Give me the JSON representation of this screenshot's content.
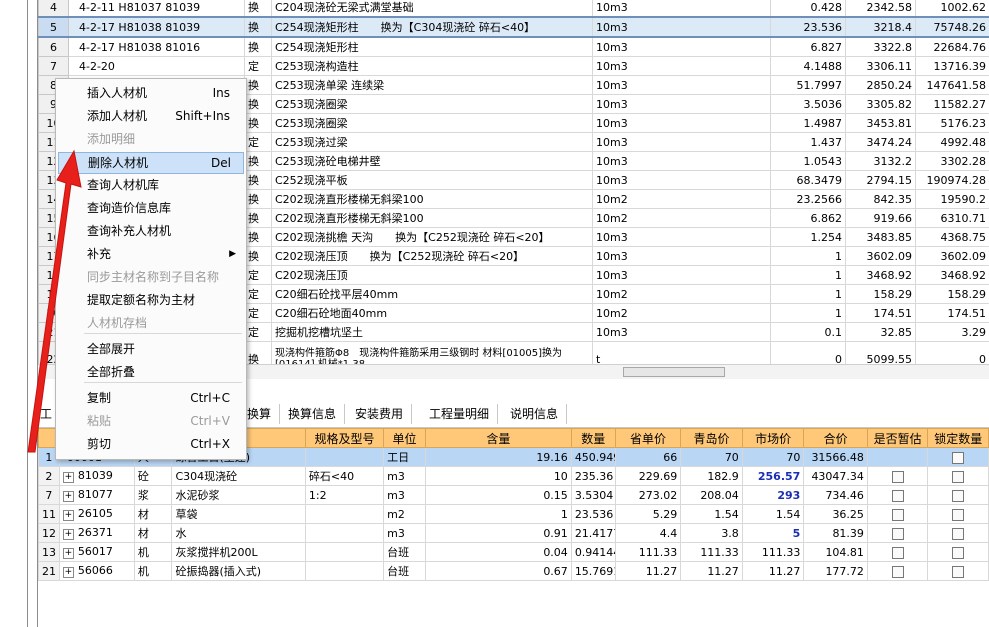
{
  "top_table": {
    "rows": [
      {
        "n": "4",
        "code": "4-2-11 H81037 81039",
        "type": "换",
        "name": "C204现浇砼无梁式满堂基础",
        "unit": "10m3",
        "qty": "0.428",
        "price": "2342.58",
        "total": "1002.62"
      },
      {
        "n": "5",
        "code": "4-2-17 H81038 81039",
        "type": "换",
        "name": "C254现浇矩形柱　　换为【C304现浇砼 碎石<40】",
        "unit": "10m3",
        "qty": "23.536",
        "price": "3218.4",
        "total": "75748.26"
      },
      {
        "n": "6",
        "code": "4-2-17 H81038 81016",
        "type": "换",
        "name": "C254现浇矩形柱",
        "unit": "10m3",
        "qty": "6.827",
        "price": "3322.8",
        "total": "22684.76"
      },
      {
        "n": "7",
        "code": "4-2-20",
        "type": "定",
        "name": "C253现浇构造柱",
        "unit": "10m3",
        "qty": "4.1488",
        "price": "3306.11",
        "total": "13716.39"
      },
      {
        "n": "8",
        "code": "",
        "type": "换",
        "name": "C253现浇单梁 连续梁",
        "unit": "10m3",
        "qty": "51.7997",
        "price": "2850.24",
        "total": "147641.58"
      },
      {
        "n": "9",
        "code": "",
        "type": "换",
        "name": "C253现浇圈梁",
        "unit": "10m3",
        "qty": "3.5036",
        "price": "3305.82",
        "total": "11582.27"
      },
      {
        "n": "10",
        "code": "",
        "type": "换",
        "name": "C253现浇圈梁",
        "unit": "10m3",
        "qty": "1.4987",
        "price": "3453.81",
        "total": "5176.23"
      },
      {
        "n": "11",
        "code": "",
        "type": "定",
        "name": "C253现浇过梁",
        "unit": "10m3",
        "qty": "1.437",
        "price": "3474.24",
        "total": "4992.48"
      },
      {
        "n": "12",
        "code": "",
        "type": "换",
        "name": "C253现浇砼电梯井壁",
        "unit": "10m3",
        "qty": "1.0543",
        "price": "3132.2",
        "total": "3302.28"
      },
      {
        "n": "13",
        "code": "",
        "type": "换",
        "name": "C252现浇平板",
        "unit": "10m3",
        "qty": "68.3479",
        "price": "2794.15",
        "total": "190974.28"
      },
      {
        "n": "14",
        "code": "",
        "type": "换",
        "name": "C202现浇直形楼梯无斜梁100",
        "unit": "10m2",
        "qty": "23.2566",
        "price": "842.35",
        "total": "19590.2"
      },
      {
        "n": "15",
        "code": "",
        "type": "换",
        "name": "C202现浇直形楼梯无斜梁100",
        "unit": "10m2",
        "qty": "6.862",
        "price": "919.66",
        "total": "6310.71"
      },
      {
        "n": "16",
        "code": "",
        "type": "换",
        "name": "C202现浇挑檐 天沟　　换为【C252现浇砼 碎石<20】",
        "unit": "10m3",
        "qty": "1.254",
        "price": "3483.85",
        "total": "4368.75"
      },
      {
        "n": "17",
        "code": "",
        "type": "换",
        "name": "C202现浇压顶　　换为【C252现浇砼 碎石<20】",
        "unit": "10m3",
        "qty": "1",
        "price": "3602.09",
        "total": "3602.09"
      },
      {
        "n": "18",
        "code": "",
        "type": "定",
        "name": "C202现浇压顶",
        "unit": "10m3",
        "qty": "1",
        "price": "3468.92",
        "total": "3468.92"
      },
      {
        "n": "19",
        "code": "",
        "type": "定",
        "name": "C20细石砼找平层40mm",
        "unit": "10m2",
        "qty": "1",
        "price": "158.29",
        "total": "158.29"
      },
      {
        "n": "20",
        "code": "",
        "type": "定",
        "name": "C20细石砼地面40mm",
        "unit": "10m2",
        "qty": "1",
        "price": "174.51",
        "total": "174.51"
      },
      {
        "n": "21",
        "code": "",
        "type": "定",
        "name": "挖掘机挖槽坑坚土",
        "unit": "10m3",
        "qty": "0.1",
        "price": "32.85",
        "total": "3.29"
      },
      {
        "n": "22",
        "code": "",
        "type": "换",
        "name": "现浇构件箍筋Φ8　现浇构件箍筋采用三级钢时 材料[01005]换为[01614],机械*1.38",
        "unit": "t",
        "qty": "0",
        "price": "5099.55",
        "total": "0"
      }
    ]
  },
  "tabs": [
    "工",
    "换算",
    "换算信息",
    "安装费用",
    "工程量明细",
    "说明信息"
  ],
  "bottom_table": {
    "headers": [
      "",
      "",
      "",
      "",
      "规格及型号",
      "单位",
      "含量",
      "数量",
      "省单价",
      "青岛价",
      "市场价",
      "合价",
      "是否暂估",
      "锁定数量"
    ],
    "rows": [
      {
        "n": "1",
        "code": "00001",
        "t": "人",
        "name": "综合工日(土建)",
        "spec": "",
        "unit": "工日",
        "content": "19.16",
        "qty": "450.949",
        "prov": "66",
        "qd": "70",
        "market": "70",
        "total": "31566.48"
      },
      {
        "n": "2",
        "code": "81039",
        "t": "砼",
        "name": "C304现浇砼",
        "spec": "碎石<40",
        "unit": "m3",
        "content": "10",
        "qty": "235.36",
        "prov": "229.69",
        "qd": "182.9",
        "market": "256.57",
        "total": "43047.34"
      },
      {
        "n": "7",
        "code": "81077",
        "t": "浆",
        "name": "水泥砂浆",
        "spec": "1:2",
        "unit": "m3",
        "content": "0.15",
        "qty": "3.5304",
        "prov": "273.02",
        "qd": "208.04",
        "market": "293",
        "total": "734.46"
      },
      {
        "n": "11",
        "code": "26105",
        "t": "材",
        "name": "草袋",
        "spec": "",
        "unit": "m2",
        "content": "1",
        "qty": "23.536",
        "prov": "5.29",
        "qd": "1.54",
        "market": "1.54",
        "total": "36.25"
      },
      {
        "n": "12",
        "code": "26371",
        "t": "材",
        "name": "水",
        "spec": "",
        "unit": "m3",
        "content": "0.91",
        "qty": "21.4177",
        "prov": "4.4",
        "qd": "3.8",
        "market": "5",
        "total": "81.39"
      },
      {
        "n": "13",
        "code": "56017",
        "t": "机",
        "name": "灰浆搅拌机200L",
        "spec": "",
        "unit": "台班",
        "content": "0.04",
        "qty": "0.94144",
        "prov": "111.33",
        "qd": "111.33",
        "market": "111.33",
        "total": "104.81"
      },
      {
        "n": "21",
        "code": "56066",
        "t": "机",
        "name": "砼振捣器(插入式)",
        "spec": "",
        "unit": "台班",
        "content": "0.67",
        "qty": "15.7691",
        "prov": "11.27",
        "qd": "11.27",
        "market": "11.27",
        "total": "177.72"
      }
    ]
  },
  "context_menu": {
    "items": [
      {
        "label": "插入人材机",
        "shortcut": "Ins"
      },
      {
        "label": "添加人材机",
        "shortcut": "Shift+Ins"
      },
      {
        "label": "添加明细",
        "shortcut": ""
      },
      {
        "label": "删除人材机",
        "shortcut": "Del"
      },
      {
        "label": "查询人材机库",
        "shortcut": ""
      },
      {
        "label": "查询造价信息库",
        "shortcut": ""
      },
      {
        "label": "查询补充人材机",
        "shortcut": ""
      },
      {
        "label": "补充",
        "shortcut": ""
      },
      {
        "label": "同步主材名称到子目名称",
        "shortcut": ""
      },
      {
        "label": "提取定额名称为主材",
        "shortcut": ""
      },
      {
        "label": "人材机存档",
        "shortcut": ""
      },
      {
        "label": "全部展开",
        "shortcut": ""
      },
      {
        "label": "全部折叠",
        "shortcut": ""
      },
      {
        "label": "复制",
        "shortcut": "Ctrl+C"
      },
      {
        "label": "粘贴",
        "shortcut": "Ctrl+V"
      },
      {
        "label": "剪切",
        "shortcut": "Ctrl+X"
      }
    ]
  },
  "colors": {
    "header": "#ffc878",
    "selected": "#b9d6f5",
    "arrow": "#e8201c",
    "highlight": "#1a2fb3"
  }
}
